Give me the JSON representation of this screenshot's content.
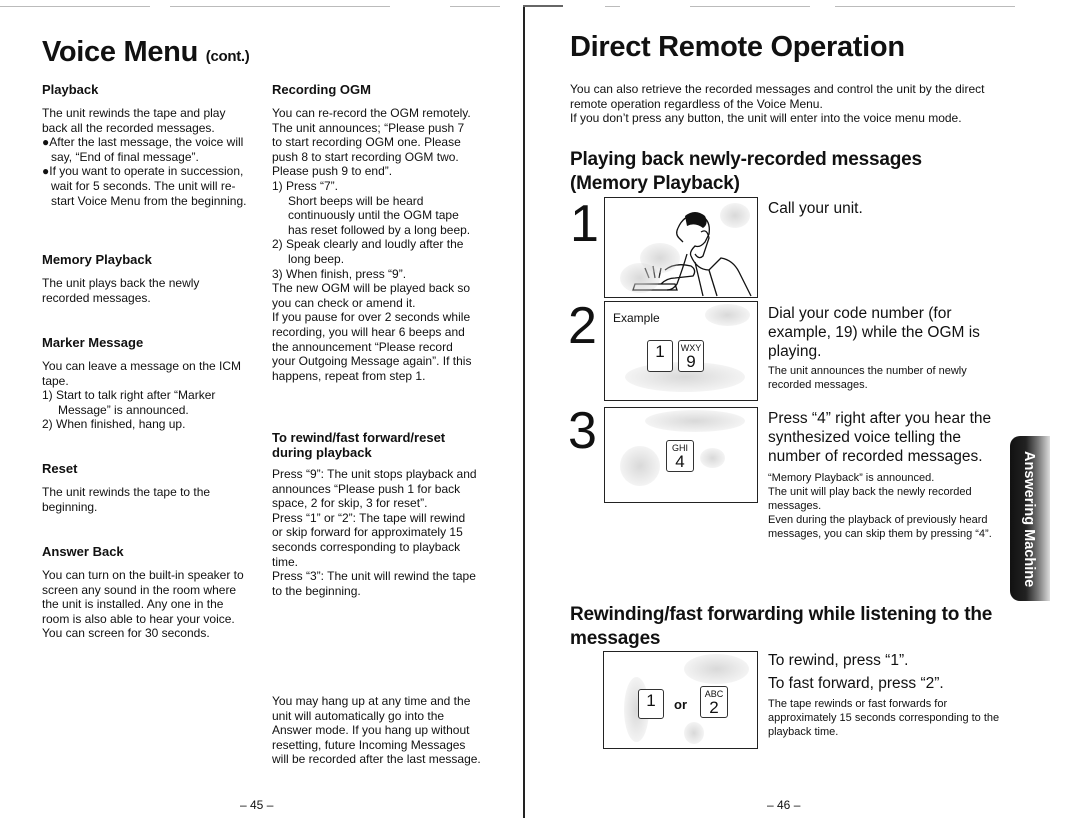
{
  "left_page": {
    "title": "Voice Menu",
    "title_suffix": "(cont.)",
    "page_number": "– 45 –",
    "playback": {
      "heading": "Playback",
      "text": "The unit rewinds the tape and play back all the recorded messages.",
      "bullets": [
        "●After the last message, the voice will say, “End of final message”.",
        "●If you want to operate in succession, wait for 5 seconds. The unit will re-start Voice Menu from the beginning."
      ]
    },
    "memory_playback": {
      "heading": "Memory Playback",
      "text": "The unit plays back the newly recorded messages."
    },
    "marker_message": {
      "heading": "Marker Message",
      "text": "You can leave a message on the ICM tape.",
      "steps": [
        "1)  Start to talk right after “Marker Message” is announced.",
        "2)  When finished, hang up."
      ]
    },
    "reset": {
      "heading": "Reset",
      "text": "The unit rewinds the tape to the beginning."
    },
    "answer_back": {
      "heading": "Answer Back",
      "text": "You can turn on the built-in speaker to screen any sound in the room where the unit is installed. Any one in the room is also able to hear your voice. You can screen for 30 seconds."
    },
    "recording_ogm": {
      "heading": "Recording OGM",
      "text": "You can re-record the OGM remotely. The unit announces; “Please push 7 to start recording OGM one. Please push 8 to start recording OGM two. Please push 9 to end”.",
      "step1": "1)  Press “7”.",
      "step1_detail": "Short beeps will be heard continuously until the OGM tape has reset followed by a long beep.",
      "step2": "2)  Speak clearly and loudly after the long beep.",
      "step3": "3)  When finish, press “9”.",
      "after": "The new OGM will be played back so you can check or amend it.",
      "pause_note": "If you pause for over 2 seconds while recording, you will hear 6 beeps and the announcement “Please record your Outgoing Message again”. If this happens, repeat from step 1."
    },
    "rewind_ff": {
      "heading": "To rewind/fast forward/reset during playback",
      "lines": [
        "Press “9”: The unit stops playback and announces “Please push 1 for back space, 2 for skip, 3 for reset”.",
        "Press “1” or “2”: The tape will rewind or skip forward for approximately 15 seconds corresponding to playback time.",
        "Press “3”: The unit will rewind the tape to the beginning."
      ]
    },
    "hang_up_note": "You may hang up at any time and the unit will automatically go into the Answer mode. If you hang up without resetting, future Incoming Messages will be recorded after the last message."
  },
  "right_page": {
    "title": "Direct Remote Operation",
    "intro": [
      "You can also retrieve the recorded messages and control the unit by the direct remote operation regardless of the Voice Menu.",
      "If you don’t press any button, the unit will enter into the voice menu mode."
    ],
    "section1_heading": "Playing back newly-recorded messages (Memory Playback)",
    "steps": [
      {
        "number": "1",
        "instruction": "Call your unit.",
        "illustration": "man-calling-on-phone"
      },
      {
        "number": "2",
        "illus_label": "Example",
        "keys": [
          {
            "sub": "",
            "digit": "1"
          },
          {
            "sub": "WXY",
            "digit": "9"
          }
        ],
        "instruction": "Dial your code number (for example, 19) while the OGM is playing.",
        "note": "The unit announces the number of newly recorded messages."
      },
      {
        "number": "3",
        "keys": [
          {
            "sub": "GHI",
            "digit": "4"
          }
        ],
        "instruction": "Press “4” right after you hear the synthesized voice telling the number of recorded messages.",
        "notes": [
          "“Memory Playback” is announced.",
          "The unit will play back the newly recorded messages.",
          "Even during the playback of previously heard messages, you can skip them by pressing “4”."
        ]
      }
    ],
    "section2_heading": "Rewinding/fast forwarding while listening to the messages",
    "rewind": {
      "keys": [
        {
          "sub": "",
          "digit": "1"
        },
        {
          "sub": "ABC",
          "digit": "2"
        }
      ],
      "or_label": "or",
      "line1": "To rewind, press “1”.",
      "line2": "To fast forward, press “2”.",
      "note": "The tape rewinds or fast forwards for approximately 15 seconds corresponding to the playback time."
    },
    "side_tab": "Answering Machine",
    "page_number": "– 46 –"
  }
}
